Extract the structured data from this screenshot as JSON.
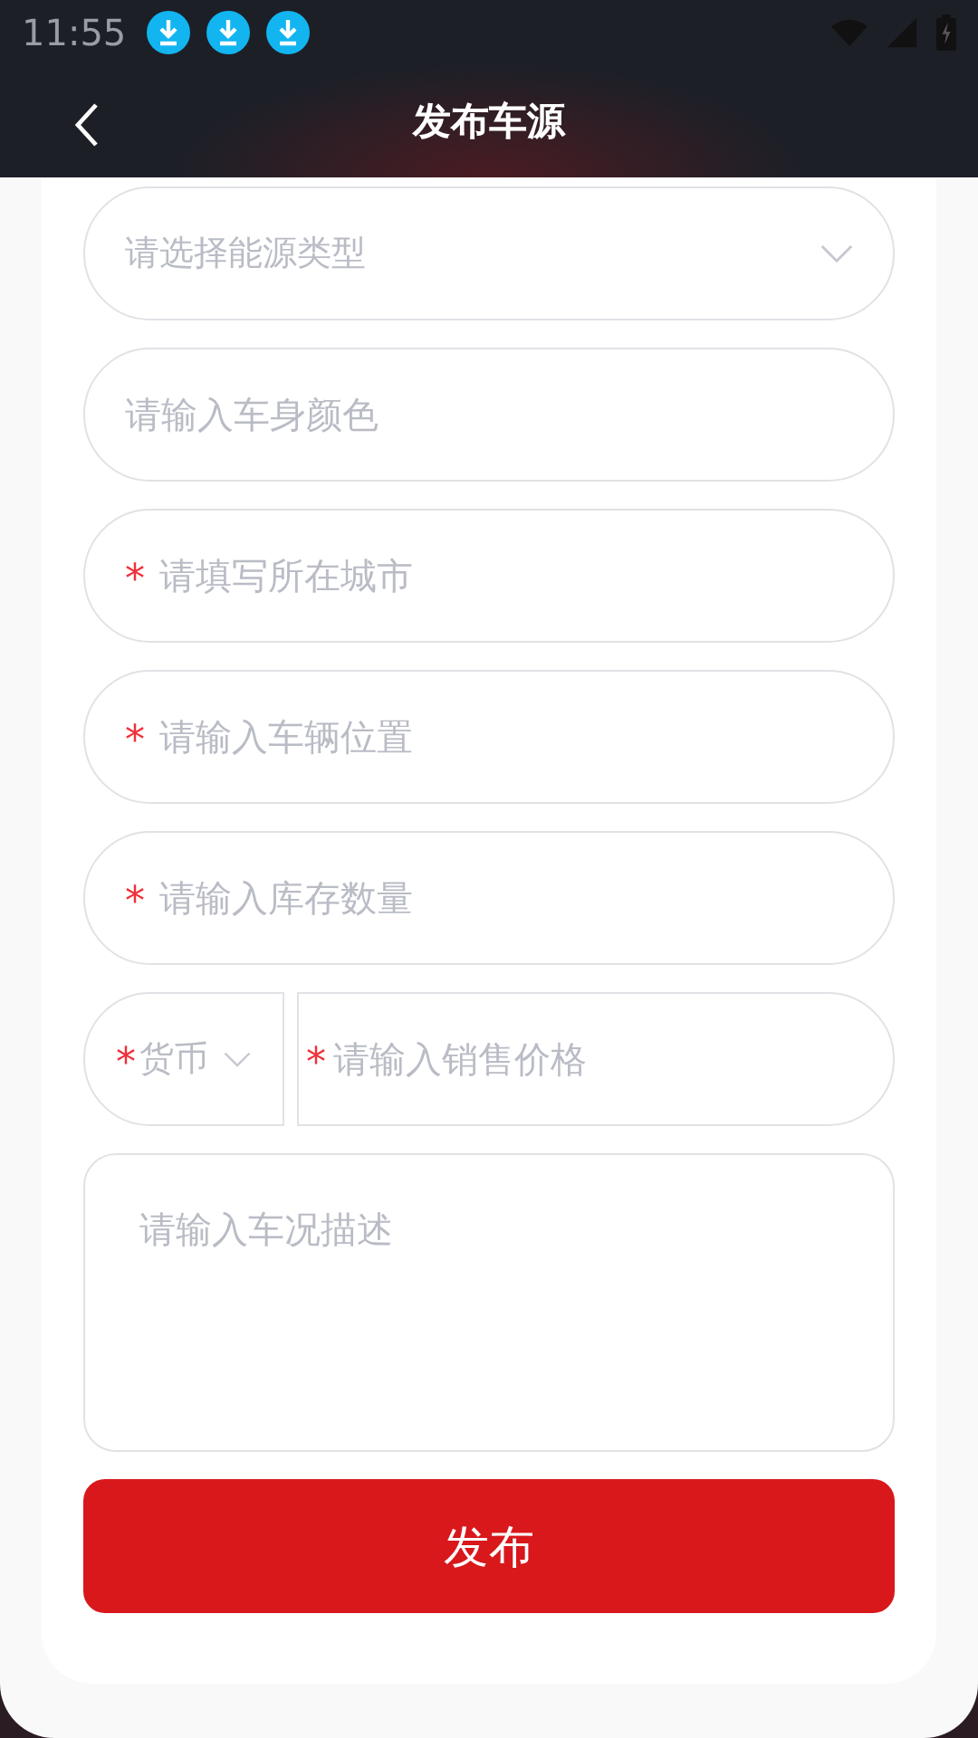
{
  "status_bar": {
    "time": "11:55"
  },
  "header": {
    "title": "发布车源"
  },
  "fields": [
    {
      "kind": "select",
      "placeholder": "请选择能源类型"
    },
    {
      "kind": "input",
      "placeholder": "请输入车身颜色"
    },
    {
      "kind": "input",
      "placeholder": "请填写所在城市",
      "required_mark": "*"
    },
    {
      "kind": "input",
      "placeholder": "请输入车辆位置",
      "required_mark": "*"
    },
    {
      "kind": "input",
      "placeholder": "请输入库存数量",
      "required_mark": "*"
    }
  ],
  "price_row": {
    "currency": {
      "placeholder": "货币",
      "required_mark": "*"
    },
    "price": {
      "placeholder": "请输入销售价格",
      "required_mark": "*"
    }
  },
  "description": {
    "placeholder": "请输入车况描述"
  },
  "submit_button": "发布"
}
